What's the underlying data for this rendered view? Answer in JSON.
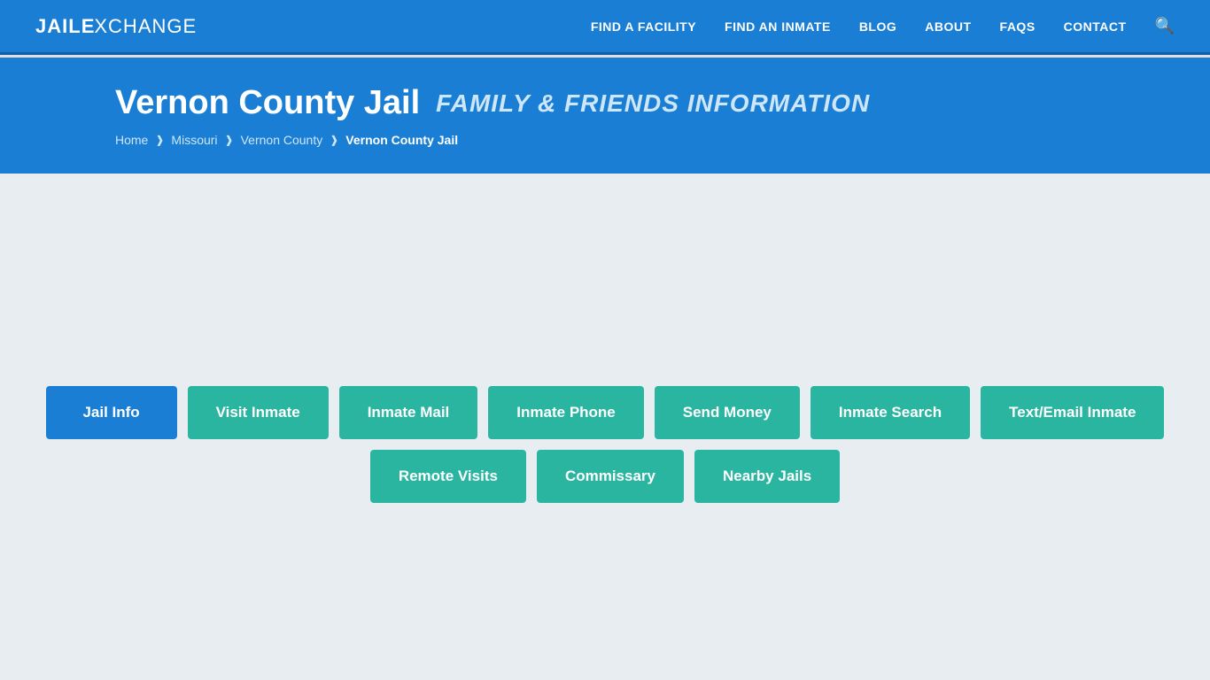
{
  "header": {
    "logo_jail": "JAIL",
    "logo_exchange": "XCHANGE",
    "nav": [
      {
        "label": "FIND A FACILITY",
        "id": "nav-find-facility"
      },
      {
        "label": "FIND AN INMATE",
        "id": "nav-find-inmate"
      },
      {
        "label": "BLOG",
        "id": "nav-blog"
      },
      {
        "label": "ABOUT",
        "id": "nav-about"
      },
      {
        "label": "FAQs",
        "id": "nav-faqs"
      },
      {
        "label": "CONTACT",
        "id": "nav-contact"
      }
    ]
  },
  "hero": {
    "title_main": "Vernon County Jail",
    "title_sub": "FAMILY & FRIENDS INFORMATION",
    "breadcrumb": [
      {
        "label": "Home",
        "active": false
      },
      {
        "label": "Missouri",
        "active": false
      },
      {
        "label": "Vernon County",
        "active": false
      },
      {
        "label": "Vernon County Jail",
        "active": true
      }
    ]
  },
  "buttons": {
    "row1": [
      {
        "label": "Jail Info",
        "style": "blue"
      },
      {
        "label": "Visit Inmate",
        "style": "teal"
      },
      {
        "label": "Inmate Mail",
        "style": "teal"
      },
      {
        "label": "Inmate Phone",
        "style": "teal"
      },
      {
        "label": "Send Money",
        "style": "teal"
      },
      {
        "label": "Inmate Search",
        "style": "teal"
      },
      {
        "label": "Text/Email Inmate",
        "style": "teal"
      }
    ],
    "row2": [
      {
        "label": "Remote Visits",
        "style": "teal"
      },
      {
        "label": "Commissary",
        "style": "teal"
      },
      {
        "label": "Nearby Jails",
        "style": "teal"
      }
    ]
  }
}
